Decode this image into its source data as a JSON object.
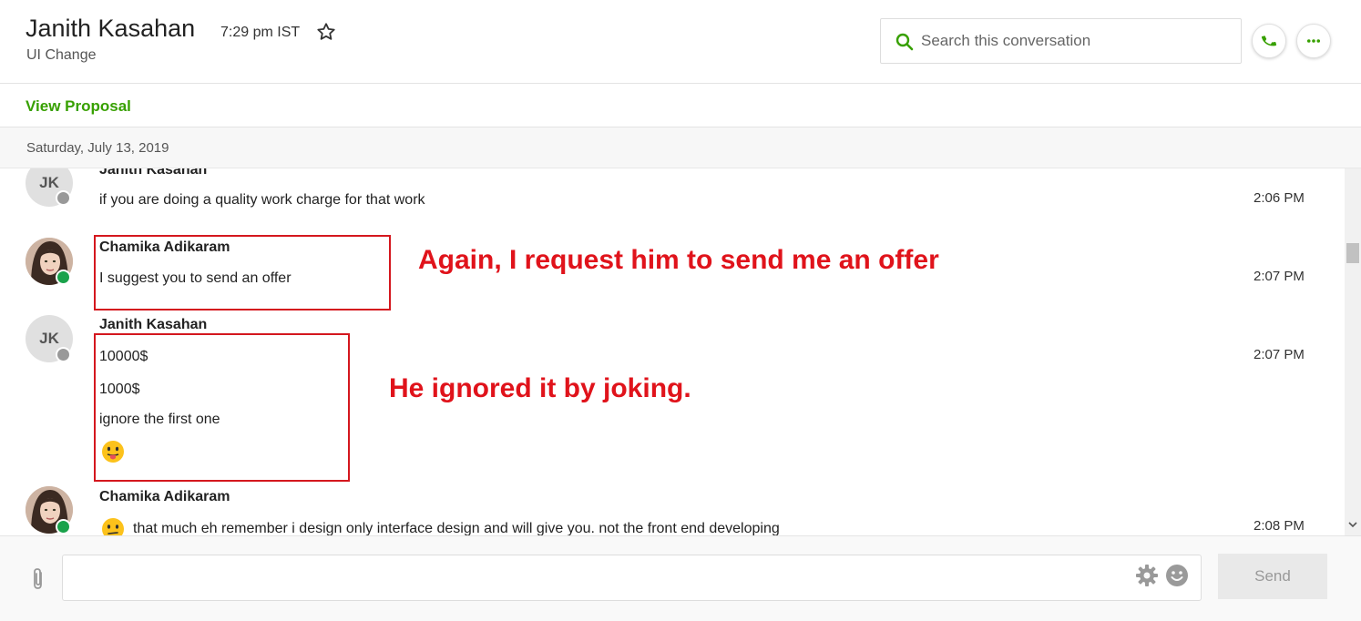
{
  "header": {
    "contact_name": "Janith Kasahan",
    "local_time": "7:29 pm IST",
    "subject": "UI Change",
    "search_placeholder": "Search this conversation"
  },
  "proposal": {
    "link_label": "View Proposal"
  },
  "date_separator": "Saturday, July 13, 2019",
  "messages": [
    {
      "sender": "Janith Kasahan",
      "initials": "JK",
      "text": "if you are doing a quality work charge for that work",
      "time": "2:06 PM",
      "status": "offline"
    },
    {
      "sender": "Chamika Adikaram",
      "text": "I suggest you to send an offer",
      "time": "2:07 PM",
      "status": "online"
    },
    {
      "sender": "Janith Kasahan",
      "initials": "JK",
      "lines": [
        "10000$",
        "1000$",
        "ignore the first one"
      ],
      "emoji": "tongue-out-emoji",
      "time": "2:07 PM",
      "status": "offline"
    },
    {
      "sender": "Chamika Adikaram",
      "emoji": "thinking-face-emoji",
      "text": "that much eh remember i design only interface design and will give you. not the front end developing",
      "time": "2:08 PM",
      "status": "online"
    }
  ],
  "annotations": {
    "first": "Again, I request him to send me an offer",
    "second": "He ignored it by joking."
  },
  "composer": {
    "send_label": "Send"
  },
  "colors": {
    "accent_green": "#37a000",
    "online": "#1aa24b",
    "offline": "#999999",
    "annotation_red": "#e0131b"
  }
}
